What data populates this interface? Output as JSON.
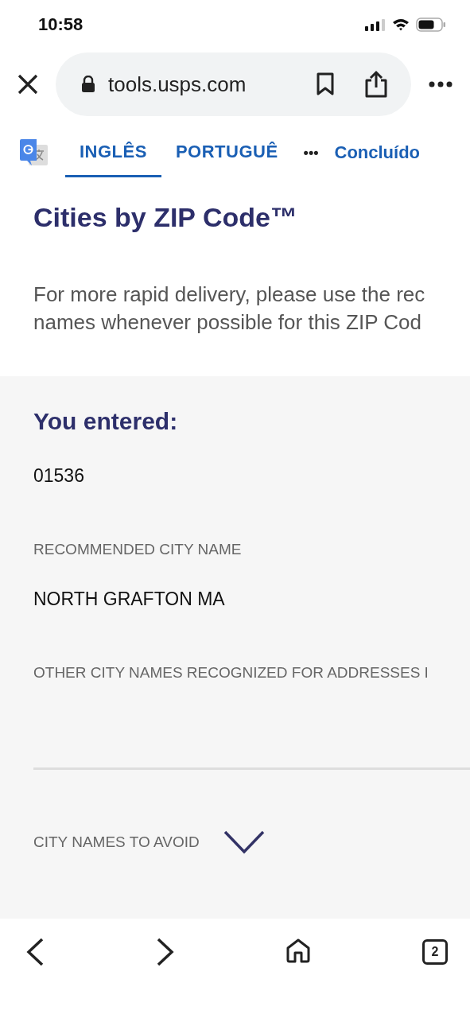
{
  "status_bar": {
    "time": "10:58"
  },
  "browser": {
    "url": "tools.usps.com"
  },
  "translate_bar": {
    "tabs": [
      {
        "label": "INGLÊS",
        "selected": true
      },
      {
        "label": "PORTUGUÊ",
        "selected": false
      }
    ],
    "more": "•••",
    "done": "Concluído"
  },
  "page": {
    "title": "Cities by ZIP Code™",
    "intro": [
      "For more rapid delivery, please use the rec",
      "names whenever possible for this ZIP Cod"
    ],
    "entered_heading": "You entered:",
    "entered_value": "01536",
    "recommended_label": "RECOMMENDED CITY NAME",
    "recommended_value": "NORTH GRAFTON MA",
    "other_label": "OTHER CITY NAMES RECOGNIZED FOR ADDRESSES I",
    "avoid_label": "CITY NAMES TO AVOID",
    "avoid_expanded": false
  },
  "toolbar": {
    "tab_count": "2"
  }
}
